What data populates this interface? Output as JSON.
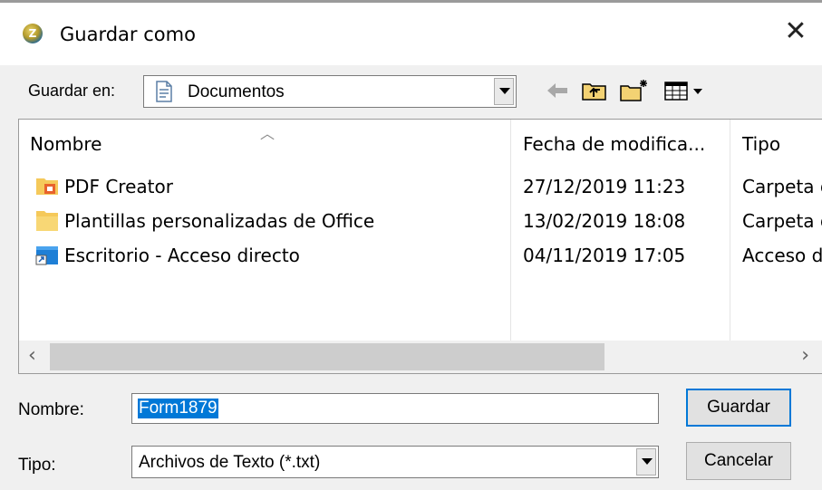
{
  "window": {
    "title": "Guardar como",
    "close_glyph": "✕"
  },
  "location": {
    "label": "Guardar en:",
    "value": "Documentos"
  },
  "toolbar": {
    "icons": [
      "back-arrow-icon",
      "up-folder-icon",
      "new-folder-icon",
      "view-menu-icon"
    ]
  },
  "file_list": {
    "columns": [
      "Nombre",
      "Fecha de modifica...",
      "Tipo"
    ],
    "rows": [
      {
        "name": "PDF Creator",
        "date": "27/12/2019 11:23",
        "type": "Carpeta d",
        "icon": "pdf-creator-folder-icon"
      },
      {
        "name": "Plantillas personalizadas de Office",
        "date": "13/02/2019 18:08",
        "type": "Carpeta d",
        "icon": "folder-icon"
      },
      {
        "name": "Escritorio - Acceso directo",
        "date": "04/11/2019 17:05",
        "type": "Acceso d",
        "icon": "desktop-shortcut-icon"
      }
    ]
  },
  "form": {
    "name_label": "Nombre:",
    "name_value": "Form1879",
    "type_label": "Tipo:",
    "type_value": "Archivos de Texto (*.txt)"
  },
  "buttons": {
    "save": "Guardar",
    "cancel": "Cancelar"
  },
  "colors": {
    "selection": "#0078d7",
    "folder": "#f5c95a"
  }
}
